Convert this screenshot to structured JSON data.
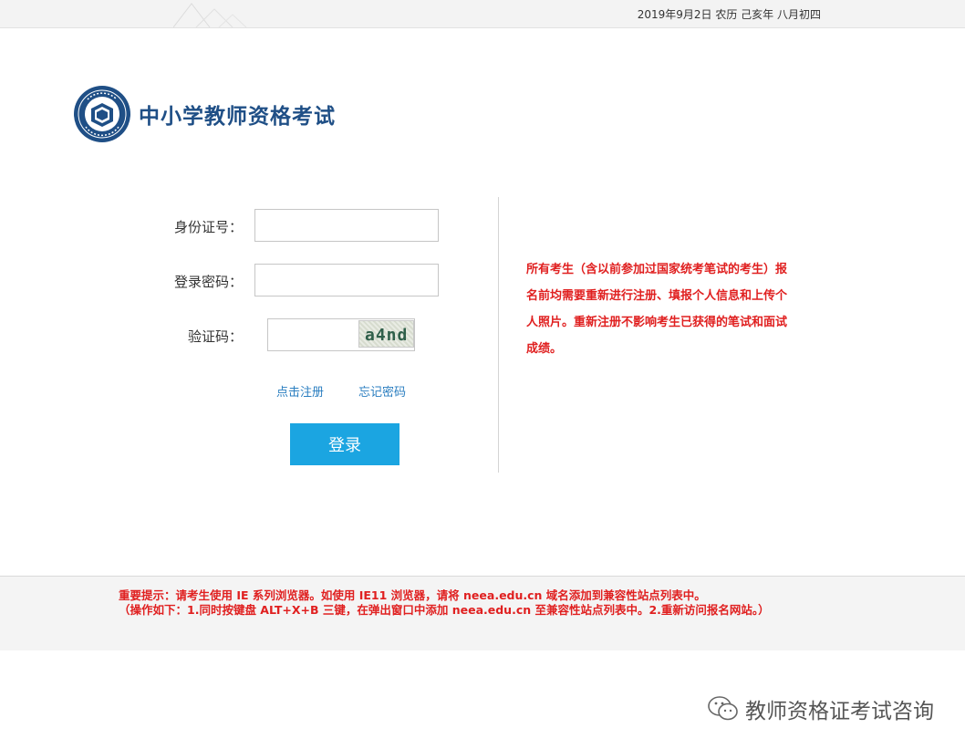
{
  "header": {
    "date_text": "2019年9月2日 农历 己亥年 八月初四"
  },
  "brand": {
    "title": "中小学教师资格考试",
    "logo_icon": "exam-seal-logo-icon",
    "title_color": "#1f4f86"
  },
  "login_form": {
    "id_label": "身份证号：",
    "id_value": "",
    "password_label": "登录密码：",
    "password_value": "",
    "captcha_label": "验证码：",
    "captcha_value": "",
    "captcha_image_text": "a4nd",
    "register_link": "点击注册",
    "forgot_link": "忘记密码",
    "login_button": "登录",
    "button_color": "#1ba5e1",
    "link_color": "#2a7ec0"
  },
  "notice": {
    "text": "所有考生（含以前参加过国家统考笔试的考生）报名前均需要重新进行注册、填报个人信息和上传个人照片。重新注册不影响考生已获得的笔试和面试成绩。",
    "color": "#e02020"
  },
  "footer": {
    "tip_line1": "重要提示：请考生使用 IE 系列浏览器。如使用 IE11 浏览器，请将 neea.edu.cn 域名添加到兼容性站点列表中。",
    "tip_line2": "（操作如下：1.同时按键盘 ALT+X+B 三键，在弹出窗口中添加 neea.edu.cn 至兼容性站点列表中。2.重新访问报名网站。）"
  },
  "watermark": {
    "icon": "wechat-icon",
    "text": "教师资格证考试咨询"
  }
}
